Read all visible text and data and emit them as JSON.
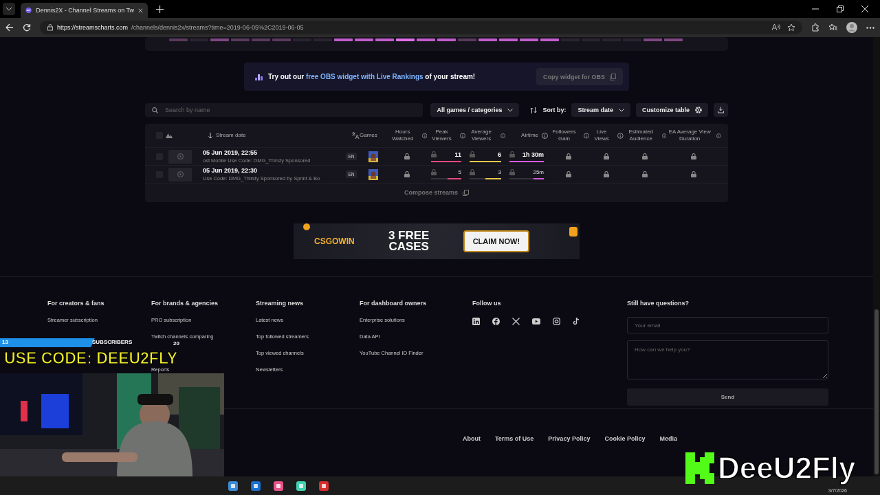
{
  "browser": {
    "tabs": [
      {
        "title": "Dennis2X - Channel Streams on Tw",
        "selected": true
      }
    ],
    "url_host": "https://streamscharts.com",
    "url_path": "/channels/dennis2x/streams?time=2019-06-05%2C2019-06-05"
  },
  "promo": {
    "before": "Try out our ",
    "link": "free OBS widget with Live Rankings",
    "after": " of your stream!",
    "button": "Copy widget for OBS"
  },
  "toolbar": {
    "search_placeholder": "Search by name",
    "games_filter": "All games / categories",
    "sort_label": "Sort by:",
    "sort_value": "Stream date",
    "customize": "Customize table"
  },
  "table": {
    "select_all_checked": false,
    "columns": [
      {
        "label": "Stream date"
      },
      {
        "label": "Games"
      },
      {
        "label": "Hours Watched"
      },
      {
        "label": "Peak Viewers"
      },
      {
        "label": "Average Viewers"
      },
      {
        "label": "Airtime"
      },
      {
        "label": "Followers Gain"
      },
      {
        "label": "Live Views"
      },
      {
        "label": "Estimated Audience"
      },
      {
        "label": "EA Average View Duration"
      }
    ],
    "rows": [
      {
        "checked": false,
        "date": "05 Jun 2019, 22:55",
        "description": "ost Mobile   Use Code: DMG_Thirsty   Sponsored",
        "language": "EN",
        "metrics": [
          {
            "kind": "locked"
          },
          {
            "kind": "bar",
            "value": "11",
            "level": 1,
            "color": "#e84a7f"
          },
          {
            "kind": "bar",
            "value": "6",
            "level": 1,
            "color": "#e8c84a"
          },
          {
            "kind": "bar",
            "value": "1h 30m",
            "level": 1,
            "color": "#d65be0"
          },
          {
            "kind": "locked"
          },
          {
            "kind": "locked"
          },
          {
            "kind": "locked"
          },
          {
            "kind": "locked"
          }
        ]
      },
      {
        "checked": false,
        "date": "05 Jun 2019, 22:30",
        "description": "Use Code: DMG_Thirsty   Sponsored by Sprint & Bo",
        "language": "EN",
        "metrics": [
          {
            "kind": "locked"
          },
          {
            "kind": "bar",
            "value": "5",
            "level": 0.45,
            "color": "#e84a7f"
          },
          {
            "kind": "bar",
            "value": "3",
            "level": 0.5,
            "color": "#e8c84a"
          },
          {
            "kind": "bar",
            "value": "25m",
            "level": 0.3,
            "color": "#d65be0"
          },
          {
            "kind": "locked"
          },
          {
            "kind": "locked"
          },
          {
            "kind": "locked"
          },
          {
            "kind": "locked"
          }
        ]
      }
    ],
    "compose": "Compose streams"
  },
  "ad": {
    "brand": "CSGOWIN",
    "offer": "3 FREE CASES",
    "cta": "CLAIM NOW!"
  },
  "footer": {
    "columns": [
      {
        "heading": "For creators & fans",
        "links": [
          "Streamer subscription"
        ]
      },
      {
        "heading": "For brands & agencies",
        "links": [
          "PRO subscription",
          "Twitch channels comparing",
          "Reports"
        ]
      },
      {
        "heading": "Streaming news",
        "links": [
          "Latest news",
          "Top followed streamers",
          "Top viewed channels",
          "Newsletters"
        ]
      },
      {
        "heading": "For dashboard owners",
        "links": [
          "Enterprise solutions",
          "Data API",
          "YouTube Channel ID Finder"
        ]
      }
    ],
    "follow_heading": "Follow us",
    "form": {
      "heading": "Still have questions?",
      "email_placeholder": "Your email",
      "message_placeholder": "How can we help you?",
      "send": "Send"
    },
    "bottom_links": [
      "About",
      "Terms of Use",
      "Privacy Policy",
      "Cookie Policy",
      "Media"
    ]
  },
  "overlay": {
    "sub_goal": {
      "current": "13",
      "label": "SUBSCRIBERS",
      "target": "20",
      "level": 0.65
    },
    "code_text": "USE CODE: DEEU2FLY",
    "logo_text": "DeeU2Fly"
  },
  "taskbar": {
    "date": "3/7/2026"
  }
}
